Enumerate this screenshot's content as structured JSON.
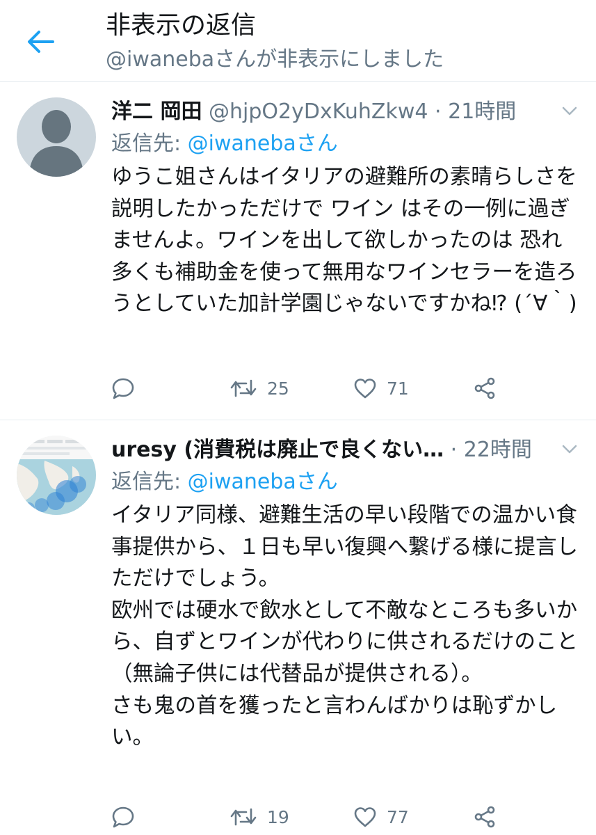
{
  "header": {
    "back_icon": "arrow-left-icon",
    "title": "非表示の返信",
    "subtitle": "@iwanebaさんが非表示にしました",
    "accent_color": "#1da1f2"
  },
  "tweets": [
    {
      "display_name": "洋二 岡田",
      "handle": "@hjpO2yDxKuhZkw4",
      "separator": "·",
      "timestamp": "21時間",
      "reply_prefix": "返信先: ",
      "reply_mention": "@iwanebaさん",
      "avatar_icon": "default-avatar-icon",
      "text": "ゆうこ姐さんはイタリアの避難所の素晴らしさを説明したかっただけで ワイン はその一例に過ぎませんよ。ワインを出して欲しかったのは 恐れ多くも補助金を使って無用なワインセラーを造ろうとしていた加計学園じゃないですかね⁉ (´∀｀)",
      "replies": "",
      "retweets": "25",
      "likes": "71"
    },
    {
      "display_name": "uresy (消費税は廃止で良くない…",
      "handle": "",
      "separator": "·",
      "timestamp": "22時間",
      "reply_prefix": "返信先: ",
      "reply_mention": "@iwanebaさん",
      "avatar_icon": "map-avatar-icon",
      "text": "イタリア同様、避難生活の早い段階での温かい食事提供から、１日も早い復興へ繋げる様に提言しただけでしょう。\n欧州では硬水で飲水として不敵なところも多いから、自ずとワインが代わりに供されるだけのこと（無論子供には代替品が提供される）。\nさも鬼の首を獲ったと言わんばかりは恥ずかしい。",
      "replies": "",
      "retweets": "19",
      "likes": "77"
    }
  ],
  "colors": {
    "text_primary": "#14171a",
    "text_secondary": "#657786",
    "link": "#1da1f2",
    "divider": "#e6ecf0"
  }
}
